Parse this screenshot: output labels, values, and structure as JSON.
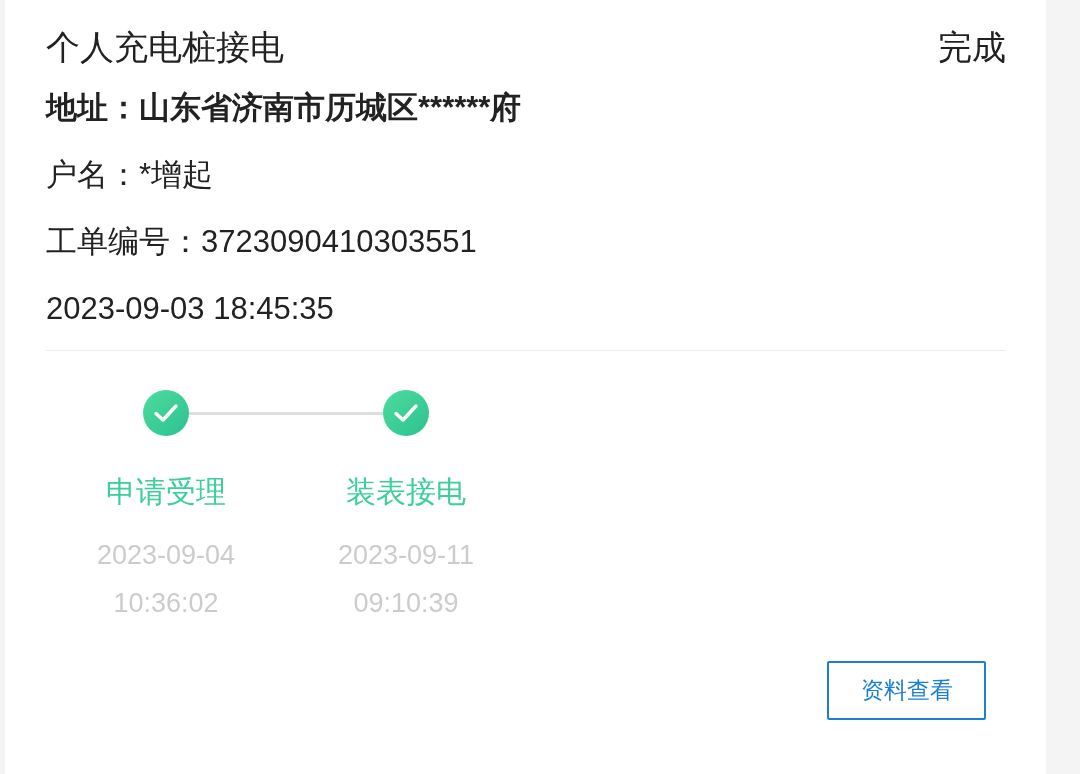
{
  "order": {
    "title": "个人充电桩接电",
    "status": "完成",
    "address": "地址：山东省济南市历城区******府",
    "account_name": "户名：*增起",
    "order_number": "工单编号：3723090410303551",
    "created": "2023-09-03 18:45:35"
  },
  "steps": [
    {
      "label": "申请受理",
      "date": "2023-09-04",
      "time": "10:36:02",
      "completed": true
    },
    {
      "label": "装表接电",
      "date": "2023-09-11",
      "time": "09:10:39",
      "completed": true
    }
  ],
  "button": "资料查看"
}
